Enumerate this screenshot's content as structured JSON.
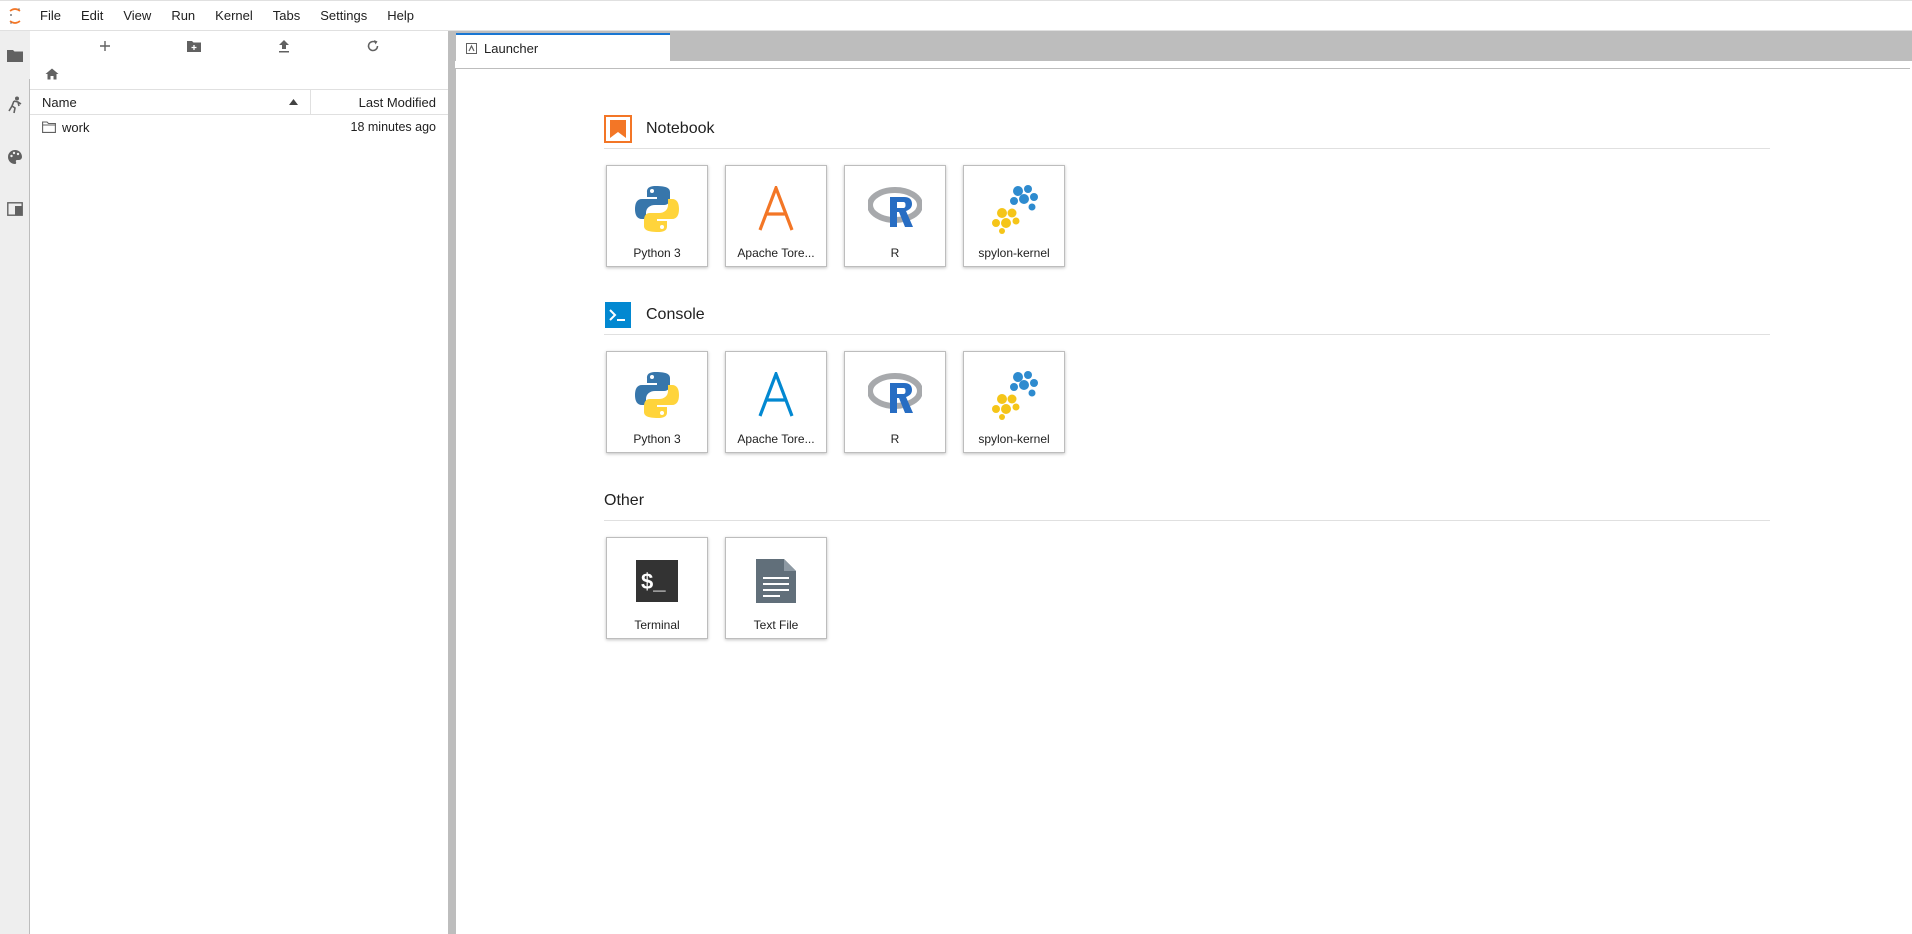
{
  "menubar": {
    "items": [
      "File",
      "Edit",
      "View",
      "Run",
      "Kernel",
      "Tabs",
      "Settings",
      "Help"
    ]
  },
  "filebrowser": {
    "columns": {
      "name": "Name",
      "modified": "Last Modified"
    },
    "rows": [
      {
        "name": "work",
        "modified": "18 minutes ago"
      }
    ]
  },
  "tabs": [
    {
      "label": "Launcher"
    }
  ],
  "launcher": {
    "sections": [
      {
        "title": "Notebook",
        "cards": [
          "Python 3",
          "Apache Tore...",
          "R",
          "spylon-kernel"
        ]
      },
      {
        "title": "Console",
        "cards": [
          "Python 3",
          "Apache Tore...",
          "R",
          "spylon-kernel"
        ]
      },
      {
        "title": "Other",
        "cards": [
          "Terminal",
          "Text File"
        ]
      }
    ]
  },
  "colors": {
    "accent": "#1976d2",
    "notebook_icon": "#f37626",
    "console_icon": "#0288d1",
    "toree_notebook": "#f37626",
    "toree_console": "#0288d1"
  }
}
